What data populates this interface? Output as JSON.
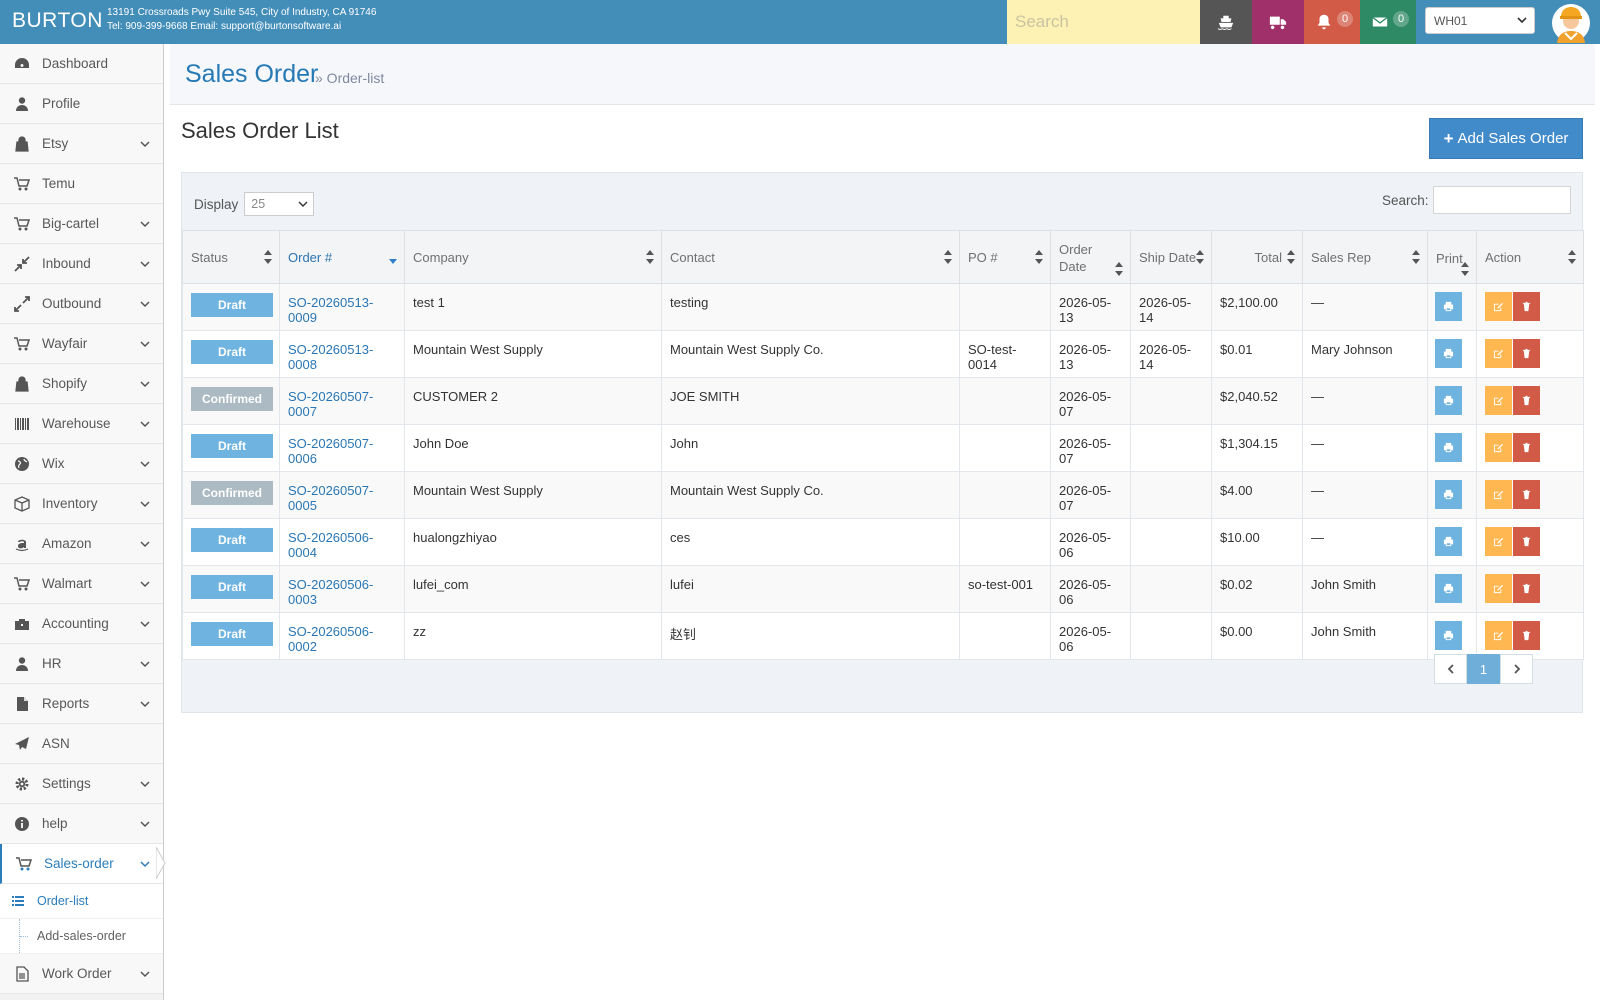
{
  "navbar": {
    "brand": "BURTON",
    "address_line1": "13191 Crossroads Pwy Suite 545, City of Industry, CA 91746",
    "address_line2": "Tel: 909-399-9668 Email: support@burtonsoftware.ai",
    "search_placeholder": "Search",
    "notifications_count": "0",
    "messages_count": "0",
    "warehouse": "WH01",
    "colors": {
      "bar": "#438eb9",
      "ship": "#555555",
      "truck": "#a0306a",
      "bell": "#d15b47",
      "mail": "#2e8965"
    }
  },
  "sidebar": {
    "items": [
      {
        "label": "Dashboard",
        "icon": "dashboard-icon",
        "expandable": false
      },
      {
        "label": "Profile",
        "icon": "user-icon",
        "expandable": false
      },
      {
        "label": "Etsy",
        "icon": "shopping-bag-icon",
        "expandable": true
      },
      {
        "label": "Temu",
        "icon": "cart-icon",
        "expandable": false
      },
      {
        "label": "Big-cartel",
        "icon": "cart-icon",
        "expandable": true
      },
      {
        "label": "Inbound",
        "icon": "inbound-arrows-icon",
        "expandable": true
      },
      {
        "label": "Outbound",
        "icon": "outbound-arrows-icon",
        "expandable": true
      },
      {
        "label": "Wayfair",
        "icon": "cart-icon",
        "expandable": true
      },
      {
        "label": "Shopify",
        "icon": "shopping-bag-icon",
        "expandable": true
      },
      {
        "label": "Warehouse",
        "icon": "barcode-icon",
        "expandable": true
      },
      {
        "label": "Wix",
        "icon": "globe-icon",
        "expandable": true
      },
      {
        "label": "Inventory",
        "icon": "cube-icon",
        "expandable": true
      },
      {
        "label": "Amazon",
        "icon": "amazon-icon",
        "expandable": true
      },
      {
        "label": "Walmart",
        "icon": "cart-icon",
        "expandable": true
      },
      {
        "label": "Accounting",
        "icon": "briefcase-icon",
        "expandable": true
      },
      {
        "label": "HR",
        "icon": "user-icon",
        "expandable": true
      },
      {
        "label": "Reports",
        "icon": "file-icon",
        "expandable": true
      },
      {
        "label": "ASN",
        "icon": "plane-icon",
        "expandable": false
      },
      {
        "label": "Settings",
        "icon": "gear-icon",
        "expandable": true
      },
      {
        "label": "help",
        "icon": "info-icon",
        "expandable": true
      }
    ],
    "active_item": {
      "label": "Sales-order",
      "icon": "cart-icon"
    },
    "sub_items": [
      {
        "label": "Order-list",
        "active": true
      },
      {
        "label": "Add-sales-order",
        "active": false
      }
    ],
    "last_item": {
      "label": "Work Order",
      "icon": "file-text-icon"
    }
  },
  "header": {
    "title": "Sales Order",
    "breadcrumb": "» Order-list"
  },
  "main": {
    "list_title": "Sales Order List",
    "add_button": "Add Sales Order",
    "display_label": "Display",
    "display_value": "25",
    "search_label": "Search:",
    "columns": [
      "Status",
      "Order #",
      "Company",
      "Contact",
      "PO #",
      "Order Date",
      "Ship Date",
      "Total",
      "Sales Rep",
      "Print",
      "Action"
    ],
    "rows": [
      {
        "status": "Draft",
        "order": "SO-20260513-0009",
        "company": "test 1",
        "contact": "testing",
        "po": "",
        "order_date": "2026-05-13",
        "ship_date": "2026-05-14",
        "total": "$2,100.00",
        "rep": "—"
      },
      {
        "status": "Draft",
        "order": "SO-20260513-0008",
        "company": "Mountain West Supply",
        "contact": "Mountain West Supply Co.",
        "po": "SO-test-0014",
        "order_date": "2026-05-13",
        "ship_date": "2026-05-14",
        "total": "$0.01",
        "rep": "Mary Johnson"
      },
      {
        "status": "Confirmed",
        "order": "SO-20260507-0007",
        "company": "CUSTOMER 2",
        "contact": "JOE SMITH",
        "po": "",
        "order_date": "2026-05-07",
        "ship_date": "",
        "total": "$2,040.52",
        "rep": "—"
      },
      {
        "status": "Draft",
        "order": "SO-20260507-0006",
        "company": "John Doe",
        "contact": "John",
        "po": "",
        "order_date": "2026-05-07",
        "ship_date": "",
        "total": "$1,304.15",
        "rep": "—"
      },
      {
        "status": "Confirmed",
        "order": "SO-20260507-0005",
        "company": "Mountain West Supply",
        "contact": "Mountain West Supply Co.",
        "po": "",
        "order_date": "2026-05-07",
        "ship_date": "",
        "total": "$4.00",
        "rep": "—"
      },
      {
        "status": "Draft",
        "order": "SO-20260506-0004",
        "company": "hualongzhiyao",
        "contact": "ces",
        "po": "",
        "order_date": "2026-05-06",
        "ship_date": "",
        "total": "$10.00",
        "rep": "—"
      },
      {
        "status": "Draft",
        "order": "SO-20260506-0003",
        "company": "lufei_com",
        "contact": "lufei",
        "po": "so-test-001",
        "order_date": "2026-05-06",
        "ship_date": "",
        "total": "$0.02",
        "rep": "John Smith"
      },
      {
        "status": "Draft",
        "order": "SO-20260506-0002",
        "company": "zz",
        "contact": "赵钊",
        "po": "",
        "order_date": "2026-05-06",
        "ship_date": "",
        "total": "$0.00",
        "rep": "John Smith"
      }
    ],
    "pagination": {
      "current": "1"
    }
  }
}
